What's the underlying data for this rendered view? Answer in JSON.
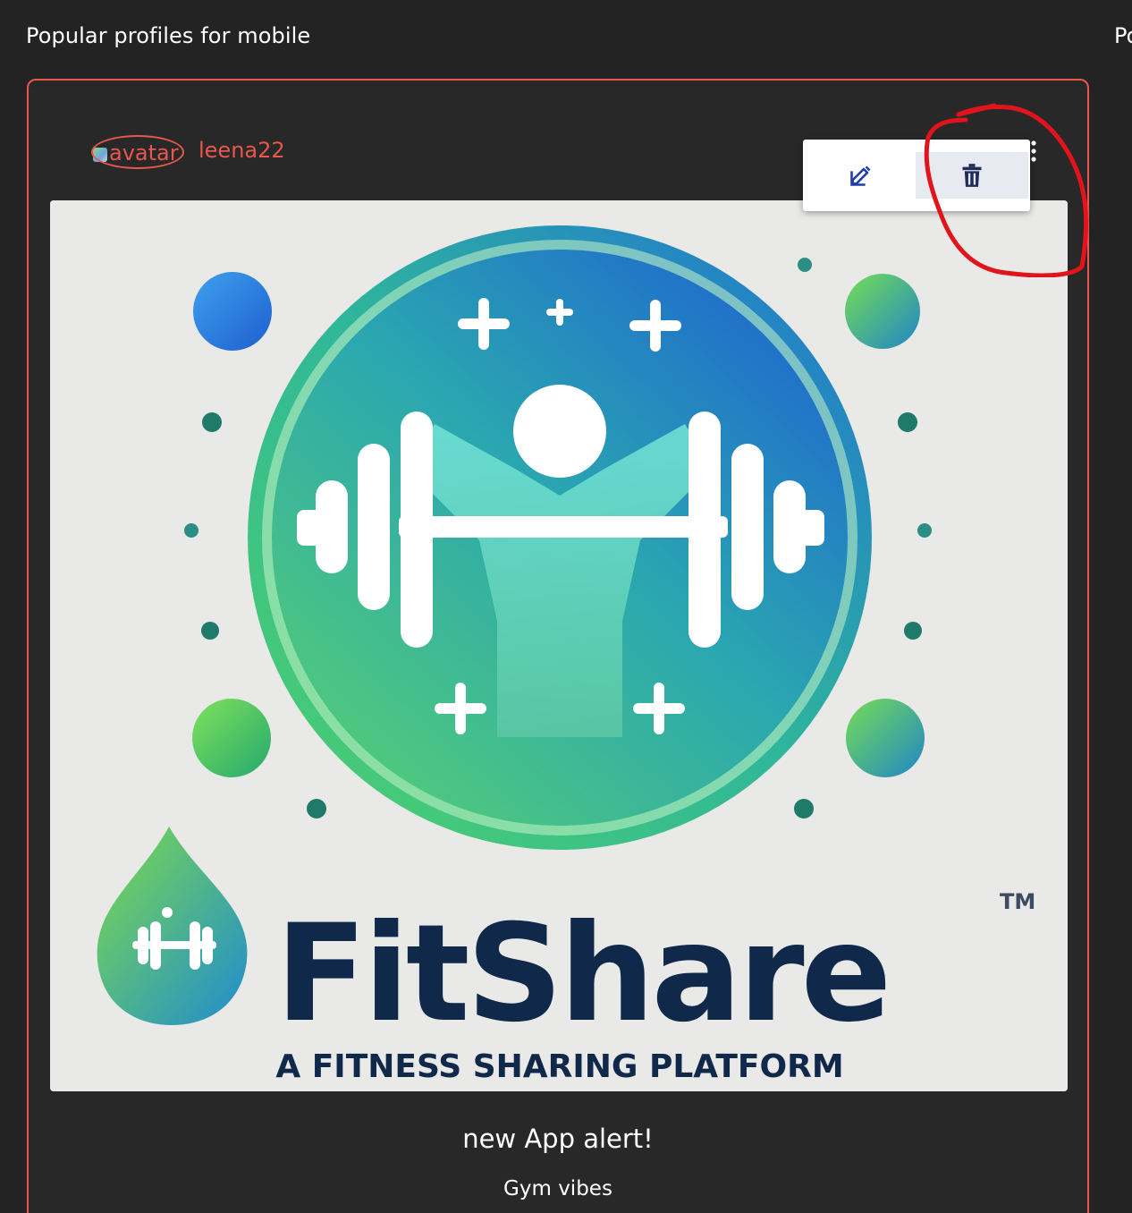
{
  "section": {
    "title": "Popular profiles for mobile",
    "next_title_clipped": "Po"
  },
  "post": {
    "avatar_alt": "avatar",
    "username": "leena22",
    "title": "new App alert!",
    "caption": "Gym vibes",
    "image": {
      "brand_name": "FitShare",
      "trademark": "TM",
      "tagline": "A FITNESS SHARING PLATFORM"
    }
  },
  "menu": {
    "edit_icon": "edit-icon",
    "delete_icon": "trash-icon",
    "more_icon": "more-vertical-icon"
  },
  "colors": {
    "accent": "#e8574d",
    "background": "#232323",
    "menu_icon": "#1f2c5c",
    "annotation": "#e2141b"
  }
}
